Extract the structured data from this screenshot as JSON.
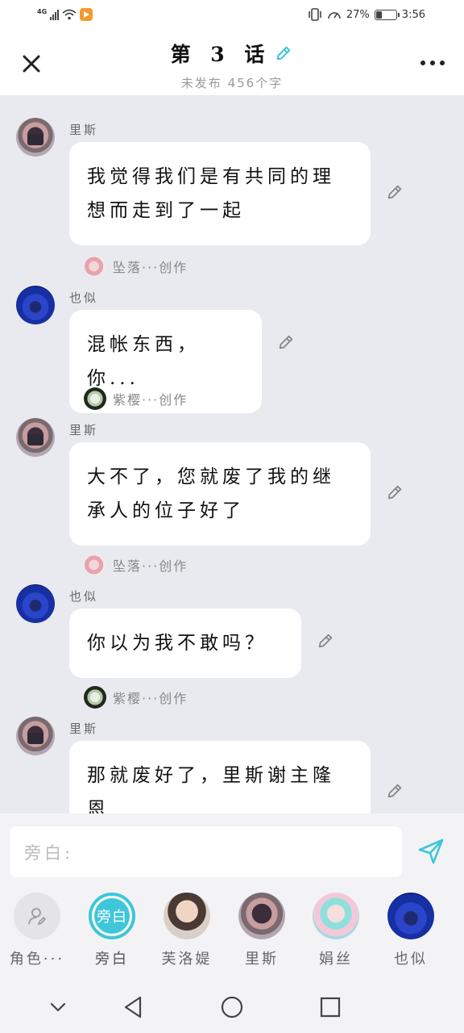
{
  "status_bar": {
    "network": "4G",
    "battery_percent": "27%",
    "time": "3:56",
    "battery_level": 0.27
  },
  "header": {
    "title": "第 3 话",
    "subtitle": "未发布 456个字"
  },
  "messages": [
    {
      "speaker": "里斯",
      "text": "我觉得我们是有共同的理想而走到了一起",
      "creator": "坠落···创作"
    },
    {
      "speaker": "也似",
      "text": "混帐东西，你...",
      "creator": "紫樱···创作"
    },
    {
      "speaker": "里斯",
      "text": "大不了，您就废了我的继承人的位子好了",
      "creator": "坠落···创作"
    },
    {
      "speaker": "也似",
      "text": "你以为我不敢吗？",
      "creator": "紫樱···创作"
    },
    {
      "speaker": "里斯",
      "text": "那就废好了，里斯谢主隆恩"
    }
  ],
  "input": {
    "placeholder": "旁白:"
  },
  "characters": [
    {
      "label": "角色···"
    },
    {
      "label": "旁白",
      "badge": "旁白"
    },
    {
      "label": "芙洛媞"
    },
    {
      "label": "里斯"
    },
    {
      "label": "娟丝"
    },
    {
      "label": "也似"
    }
  ],
  "colors": {
    "accent": "#3ec6d9",
    "background": "#e9eaef"
  }
}
